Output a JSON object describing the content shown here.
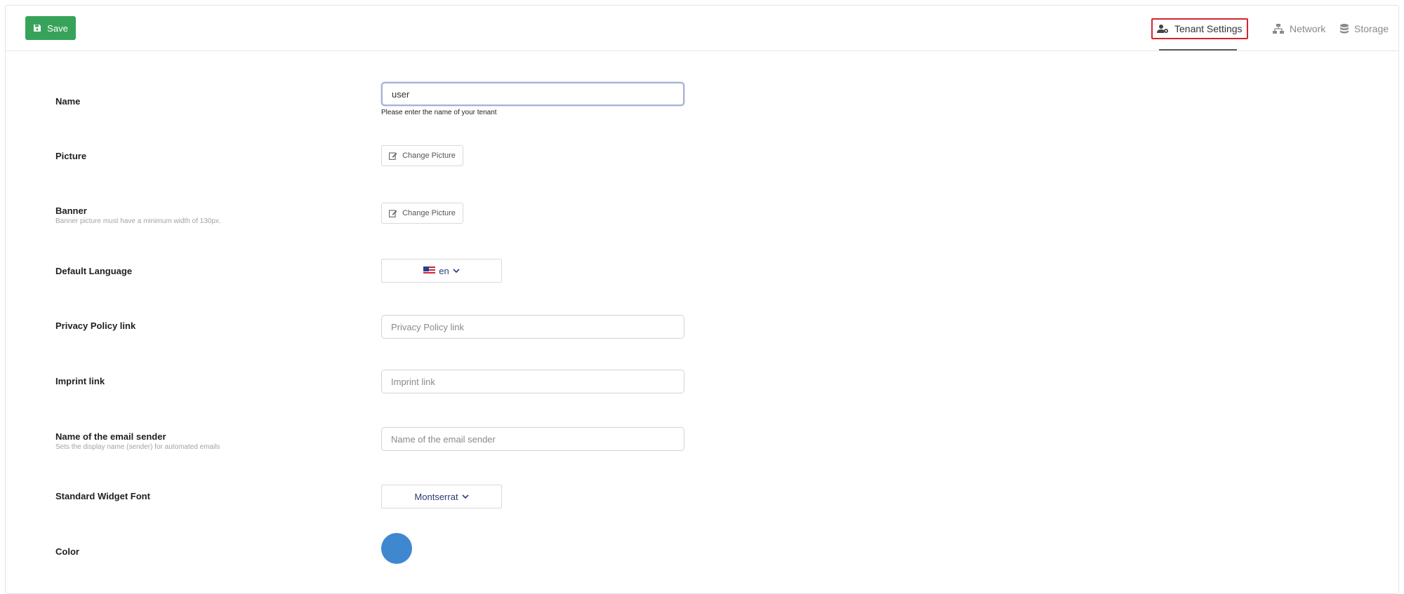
{
  "toolbar": {
    "save_label": "Save"
  },
  "tabs": [
    {
      "label": "Tenant Settings",
      "icon": "user-gear-icon",
      "active": true
    },
    {
      "label": "Network",
      "icon": "network-icon",
      "active": false
    },
    {
      "label": "Storage",
      "icon": "database-icon",
      "active": false
    }
  ],
  "form": {
    "name": {
      "label": "Name",
      "value": "user",
      "help": "Please enter the name of your tenant"
    },
    "picture": {
      "label": "Picture",
      "button": "Change Picture"
    },
    "banner": {
      "label": "Banner",
      "sublabel": "Banner picture must have a minimum width of 130px.",
      "button": "Change Picture"
    },
    "language": {
      "label": "Default Language",
      "value": "en",
      "icon": "us-flag-icon"
    },
    "privacy": {
      "label": "Privacy Policy link",
      "placeholder": "Privacy Policy link",
      "value": ""
    },
    "imprint": {
      "label": "Imprint link",
      "placeholder": "Imprint link",
      "value": ""
    },
    "email_sender": {
      "label": "Name of the email sender",
      "sublabel": "Sets the display name (sender) for automated emails",
      "placeholder": "Name of the email sender",
      "value": ""
    },
    "widget_font": {
      "label": "Standard Widget Font",
      "value": "Montserrat"
    },
    "color": {
      "label": "Color",
      "value": "#3f88d0"
    }
  },
  "colors": {
    "save": "#37a35a",
    "active_tab_outline": "#d3242b",
    "accent_text": "#2b3a78"
  }
}
